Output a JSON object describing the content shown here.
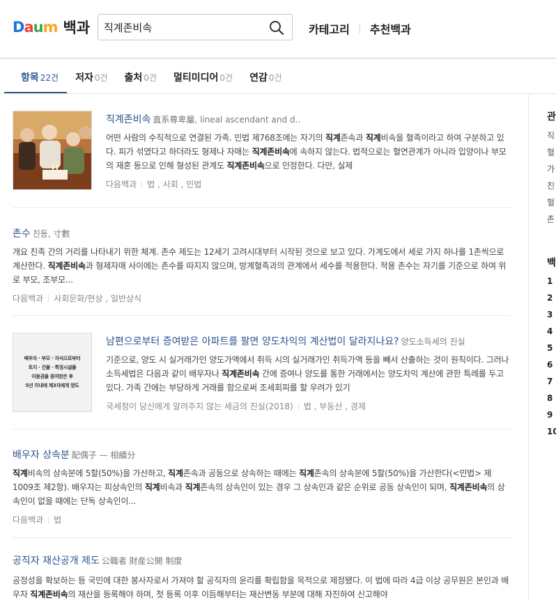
{
  "header": {
    "logo_letters": [
      "D",
      "a",
      "u",
      "m"
    ],
    "logo_colors": [
      "#1a73e8",
      "#e8453c",
      "#34a853",
      "#f5a623"
    ],
    "dict_label": "백과",
    "search_value": "직계존비속",
    "gnb": [
      "카테고리",
      "추천백과"
    ]
  },
  "tabs": [
    {
      "label": "항목",
      "count": "22건",
      "active": true
    },
    {
      "label": "저자",
      "count": "0건",
      "active": false
    },
    {
      "label": "출처",
      "count": "0건",
      "active": false
    },
    {
      "label": "멀티미디어",
      "count": "0건",
      "active": false
    },
    {
      "label": "연감",
      "count": "0건",
      "active": false
    }
  ],
  "results": [
    {
      "title": "직계존비속",
      "sub": "直系尊卑屬, lineal ascendant and d..",
      "desc_html": "어떤 사람의 수직적으로 연결된 가족. 민법 제768조에는 자기의 <b>직계</b>존속과 <b>직계</b>비속을 혈족이라고 하여 구분하고 있다. 피가 섞였다고 하더라도 형제나 자매는 <b>직계존비속</b>에 속하지 않는다. 법적으로는 혈연관계가 아니라 입양이나 부모의 재혼 등으로 인해 형성된 관계도 <b>직계존비속</b>으로 인정한다. 다만, 실제",
      "source": "다음백과",
      "category": "법 , 사회 , 민법",
      "thumb": "family-photo"
    },
    {
      "title": "촌수",
      "sub": "친등, 寸數",
      "desc_html": "개요 친족 간의 거리를 나타내기 위한 체계. 촌수 제도는 12세기 고려시대부터 시작된 것으로 보고 있다. 가계도에서 세로 가지 하나를 1촌씩으로 계산한다. <b>직계존비속</b>과 형제자매 사이에는 촌수를 따지지 않으며, 방계혈족과의 관계에서 세수를 적용한다. 적용 촌수는 자기를 기준으로 하여 위로 부모, 조부모...",
      "source": "다음백과",
      "category": "사회문화/현상 , 일반상식"
    },
    {
      "title": "남편으로부터 증여받은 아파트를 팔면 양도차익의 계산법이 달라지나요?",
      "sub": "양도소득세의 진실",
      "desc_html": "기준으로, 양도 시 실거래가인 양도가액에서 취득 시의 실거래가인 취득가액 등을 빼서 산출하는 것이 원칙이다. 그러나 소득세법은 다음과 같이 배우자나 <b>직계존비속</b> 간에 증여나 양도를 통한 거래에서는 양도차익 계산에 관한 특례를 두고 있다. 가족 간에는 부당하게 거래를 함으로써 조세회피를 할 우려가 있기",
      "source": "국세청이 당신에게 알려주지 않는 세금의 진실(2018)",
      "category": "법 , 부동산 , 경제",
      "thumb_text": [
        "배우자 · 부모 · 자식으로부터",
        "토지 · 건물 · 특정시설물",
        "이용권을 증여받은 후",
        "5년 이내에 제3자에게 양도"
      ]
    },
    {
      "title": "배우자 상속분",
      "sub": "配偶子 — 相續分",
      "desc_html": "<b>직계</b>비속의 상속분에 5할(50%)을 가산하고, <b>직계</b>존속과 공동으로 상속하는 때에는 <b>직계</b>존속의 상속분에 5할(50%)을 가산한다(<민법> 제1009조 제2항). 배우자는 피상속인의 <b>직계</b>비속과 <b>직계</b>존속의 상속인이 있는 경우 그 상속인과 같은 순위로 공동 상속인이 되며, <b>직계존비속</b>의 상속인이 없을 때에는 단독 상속인이...",
      "source": "다음백과",
      "category": "법"
    },
    {
      "title": "공직자 재산공개 제도",
      "sub": "公職者 財産公開 制度",
      "desc_html": "공정성을 확보하는 등 국민에 대한 봉사자로서 가져야 할 공직자의 윤리를 확립함을 목적으로 제정됐다. 이 법에 따라 4급 이상 공무원은 본인과 배우자 <b>직계존비속</b>의 재산을 등록해야 하며, 첫 등록 이후 이듬해부터는 재산변동 부분에 대해 자진하여 신고해야"
    }
  ],
  "right_panel": {
    "heading1": "관",
    "related": [
      "직",
      "혈",
      "가",
      "친",
      "혈",
      "촌"
    ],
    "heading2": "백",
    "numbers": [
      "1",
      "2",
      "3",
      "4",
      "5",
      "6",
      "7",
      "8",
      "9",
      "10"
    ]
  }
}
